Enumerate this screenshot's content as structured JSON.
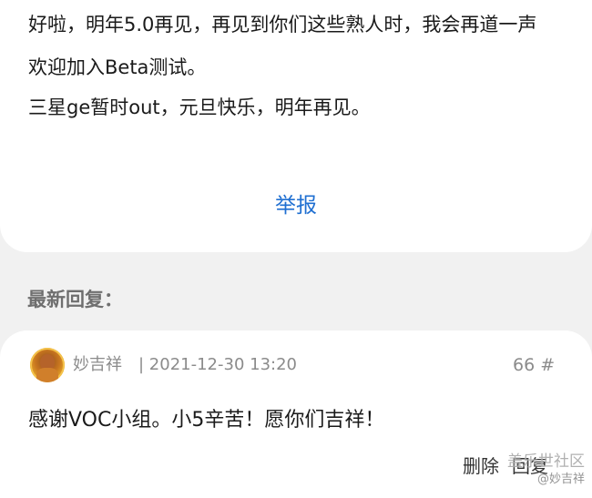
{
  "post": {
    "line1": "好啦，明年5.0再见，再见到你们这些熟人时，我会再道一声",
    "line2": "欢迎加入Beta测试。",
    "line3": "三星ge暂时out，元旦快乐，明年再见。",
    "report_label": "举报"
  },
  "section": {
    "title": "最新回复："
  },
  "reply": {
    "username": "妙吉祥",
    "separator_time": "| 2021-12-30 13:20",
    "floor": "66 #",
    "text": "感谢VOC小组。小5辛苦！愿你们吉祥！",
    "delete_label": "删除",
    "reply_label": "回复"
  },
  "watermark": {
    "line1": "盖乐世社区",
    "line2": "@妙吉祥"
  },
  "colors": {
    "link": "#1f6fd1",
    "background": "#f1f1f1",
    "card": "#ffffff",
    "muted_text": "#8b8b8b"
  }
}
